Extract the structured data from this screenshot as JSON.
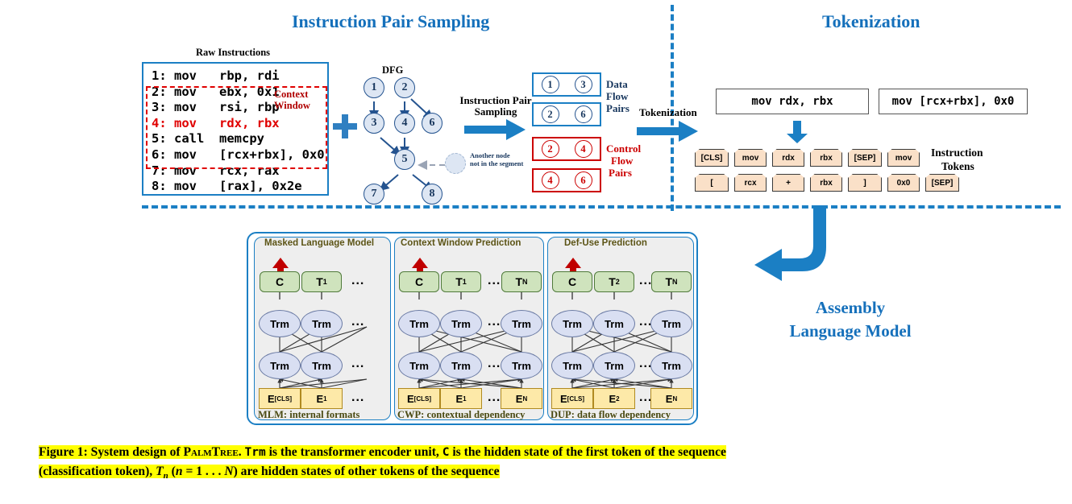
{
  "sections": {
    "instruction_pair_sampling": "Instruction Pair Sampling",
    "tokenization": "Tokenization"
  },
  "raw_instructions": {
    "title": "Raw Instructions",
    "lines": [
      {
        "text": "1: mov   rbp, rdi",
        "red": false
      },
      {
        "text": "2: mov   ebx, 0x1",
        "red": false
      },
      {
        "text": "3: mov   rsi, rbp",
        "red": false
      },
      {
        "text": "4: mov   rdx, rbx",
        "red": true
      },
      {
        "text": "5: call  memcpy",
        "red": false
      },
      {
        "text": "6: mov   [rcx+rbx], 0x0",
        "red": false
      },
      {
        "text": "7: mov   rcx, rax",
        "red": false
      },
      {
        "text": "8: mov   [rax], 0x2e",
        "red": false
      }
    ],
    "context_window_label_line1": "Context",
    "context_window_label_line2": "Window"
  },
  "plus_sign": "+",
  "dfg": {
    "title": "DFG",
    "nodes": [
      "1",
      "2",
      "3",
      "4",
      "6",
      "5",
      "7",
      "8"
    ],
    "ghost_note_line1": "Another node",
    "ghost_note_line2": "not in the segment"
  },
  "sampling_arrow": {
    "line1": "Instruction Pair",
    "line2": "Sampling"
  },
  "pairs": {
    "data_flow": {
      "label_lines": [
        "Data",
        "Flow",
        "Pairs"
      ],
      "rows": [
        [
          "1",
          "3"
        ],
        [
          "2",
          "6"
        ]
      ]
    },
    "control_flow": {
      "label_lines": [
        "Control",
        "Flow",
        "Pairs"
      ],
      "rows": [
        [
          "2",
          "4"
        ],
        [
          "4",
          "6"
        ]
      ]
    }
  },
  "tokenization_arrow_label": "Tokenization",
  "instruction_boxes": [
    "mov rdx, rbx",
    "mov [rcx+rbx], 0x0"
  ],
  "tokens": {
    "label_line1": "Instruction",
    "label_line2": "Tokens",
    "row1": [
      "[CLS]",
      "mov",
      "rdx",
      "rbx",
      "[SEP]",
      "mov"
    ],
    "row2": [
      "[",
      "rcx",
      "+",
      "rbx",
      "]",
      "0x0",
      "[SEP]"
    ]
  },
  "model": {
    "panels": [
      {
        "title": "Masked Language Model",
        "footer": "MLM: internal formats",
        "top": [
          "C",
          "T_1",
          "...",
          ""
        ],
        "top_labels": [
          {
            "main": "C",
            "sub": ""
          },
          {
            "main": "T",
            "sub": "1"
          }
        ],
        "embeddings": [
          {
            "main": "E",
            "sub": "[CLS]"
          },
          {
            "main": "E",
            "sub": "1"
          }
        ],
        "trm_label": "Trm",
        "dots": "...",
        "columns": 2,
        "has_tail": false
      },
      {
        "title": "Context Window Prediction",
        "footer": "CWP: contextual dependency",
        "top_labels": [
          {
            "main": "C",
            "sub": ""
          },
          {
            "main": "T",
            "sub": "1"
          },
          {
            "main": "T",
            "sub": "N"
          }
        ],
        "embeddings": [
          {
            "main": "E",
            "sub": "[CLS]"
          },
          {
            "main": "E",
            "sub": "1"
          },
          {
            "main": "E",
            "sub": "N"
          }
        ],
        "trm_label": "Trm",
        "dots": "...",
        "columns": 3,
        "has_tail": true
      },
      {
        "title": "Def-Use Prediction",
        "footer": "DUP: data flow dependency",
        "top_labels": [
          {
            "main": "C",
            "sub": ""
          },
          {
            "main": "T",
            "sub": "2"
          },
          {
            "main": "T",
            "sub": "N"
          }
        ],
        "embeddings": [
          {
            "main": "E",
            "sub": "[CLS]"
          },
          {
            "main": "E",
            "sub": "2"
          },
          {
            "main": "E",
            "sub": "N"
          }
        ],
        "trm_label": "Trm",
        "dots": "...",
        "columns": 3,
        "has_tail": true
      }
    ]
  },
  "assembly_model": {
    "line1": "Assembly",
    "line2": "Language Model"
  },
  "caption": {
    "l1_a": "Figure 1: System design of ",
    "l1_sc": "PalmTree",
    "l1_b": ". ",
    "l1_mono1": "Trm",
    "l1_c": " is the transformer encoder unit, ",
    "l1_mono2": "C",
    "l1_d": " is the hidden state of the first token of the sequence",
    "l2_a": "(classification token), ",
    "l2_it1": "T",
    "l2_sub": "n",
    "l2_b": " (",
    "l2_it2": "n",
    "l2_c": " = 1 . . . ",
    "l2_it3": "N",
    "l2_d": ") are hidden states of other tokens of the sequence"
  },
  "colors": {
    "accent_blue": "#1570bb",
    "red": "#cc0000",
    "token_fill": "#fae0c8",
    "green_fill": "#cfe3bd",
    "trm_fill": "#d9dff2",
    "emb_fill": "#fde9a8",
    "highlight": "#ffff00"
  }
}
